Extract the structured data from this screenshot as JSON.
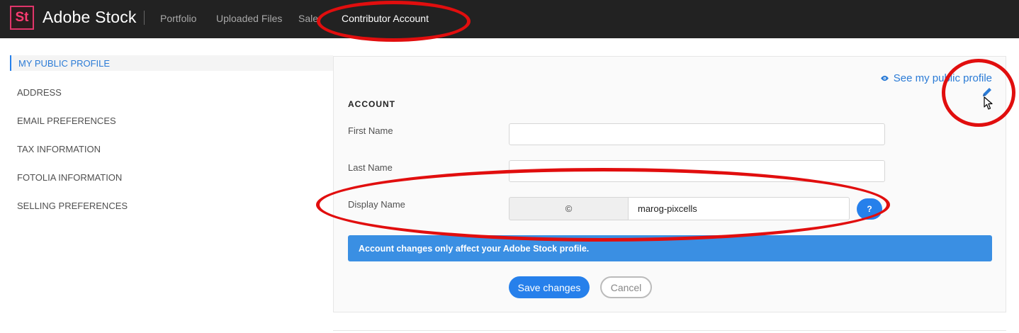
{
  "header": {
    "logo_text": "St",
    "brand": "Adobe Stock",
    "nav": [
      {
        "label": "Portfolio"
      },
      {
        "label": "Uploaded Files"
      },
      {
        "label": "Sale"
      },
      {
        "label": "Contributor Account"
      }
    ],
    "active_nav": "Contributor Account"
  },
  "sidebar": {
    "items": [
      {
        "label": "MY PUBLIC PROFILE",
        "active": true
      },
      {
        "label": "ADDRESS"
      },
      {
        "label": "EMAIL PREFERENCES"
      },
      {
        "label": "TAX INFORMATION"
      },
      {
        "label": "FOTOLIA INFORMATION"
      },
      {
        "label": "SELLING PREFERENCES"
      }
    ]
  },
  "main": {
    "public_profile_link": "See my public profile",
    "section_title": "ACCOUNT",
    "fields": {
      "first_name": {
        "label": "First Name",
        "value": ""
      },
      "last_name": {
        "label": "Last Name",
        "value": ""
      },
      "display_name": {
        "label": "Display Name",
        "prefix": "©",
        "value": "marog-pixcells"
      }
    },
    "help_label": "?",
    "info_banner": "Account changes only affect your Adobe Stock profile.",
    "save_label": "Save changes",
    "cancel_label": "Cancel"
  },
  "colors": {
    "topbar": "#222222",
    "accent": "#2680eb",
    "logo": "#ff3b72",
    "annotation": "#e10e0e"
  }
}
